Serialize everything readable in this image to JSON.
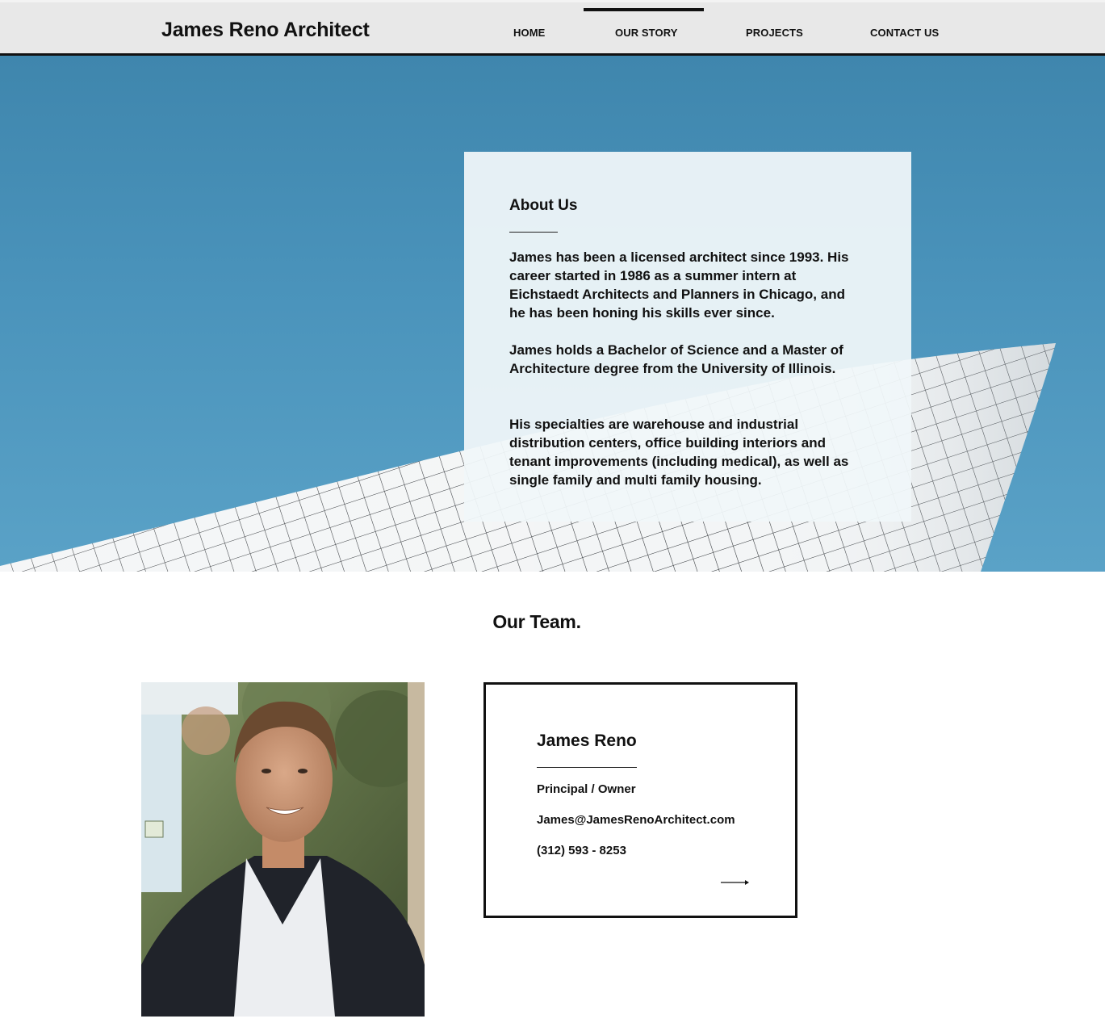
{
  "header": {
    "site_title": "James Reno Architect",
    "nav": [
      {
        "label": "HOME",
        "active": false
      },
      {
        "label": "OUR STORY",
        "active": true
      },
      {
        "label": "PROJECTS",
        "active": false
      },
      {
        "label": "CONTACT US",
        "active": false
      }
    ]
  },
  "about": {
    "title": "About Us",
    "paragraphs": [
      "James has been a licensed architect since 1993. His career started in 1986 as a summer intern at Eichstaedt Architects and Planners in Chicago, and he has been honing his skills ever since.",
      "James holds a Bachelor of Science and a Master of Architecture degree from the University of Illinois.",
      "His specialties are warehouse and industrial distribution centers, office building  interiors and tenant improvements (including medical), as well as single family and multi family housing."
    ]
  },
  "team": {
    "heading": "Our Team.",
    "member": {
      "name": "James Reno",
      "role": "Principal / Owner",
      "email": "James@JamesRenoArchitect.com",
      "phone": "(312) 593 - 8253",
      "more_icon": "arrow-right-icon"
    }
  },
  "colors": {
    "sky": "#4a93bb",
    "header_bg": "#e8e8e8",
    "text": "#111111"
  }
}
